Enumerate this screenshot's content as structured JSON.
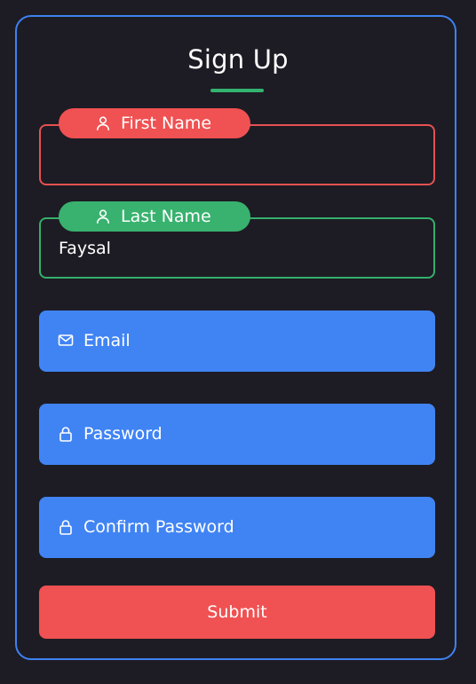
{
  "form": {
    "title": "Sign Up",
    "first_name": {
      "label": "First Name",
      "value": "",
      "icon": "user-icon",
      "state_color": "#f05152"
    },
    "last_name": {
      "label": "Last Name",
      "value": "Faysal",
      "icon": "user-icon",
      "state_color": "#38b26e"
    },
    "email": {
      "placeholder": "Email",
      "icon": "mail-icon"
    },
    "password": {
      "placeholder": "Password",
      "icon": "lock-icon"
    },
    "confirm_password": {
      "placeholder": "Confirm Password",
      "icon": "lock-icon"
    },
    "submit_label": "Submit"
  },
  "colors": {
    "background": "#1d1c24",
    "card_border": "#3e82f2",
    "accent_blue": "#4084f4",
    "error_red": "#f05152",
    "success_green": "#38b26e"
  }
}
